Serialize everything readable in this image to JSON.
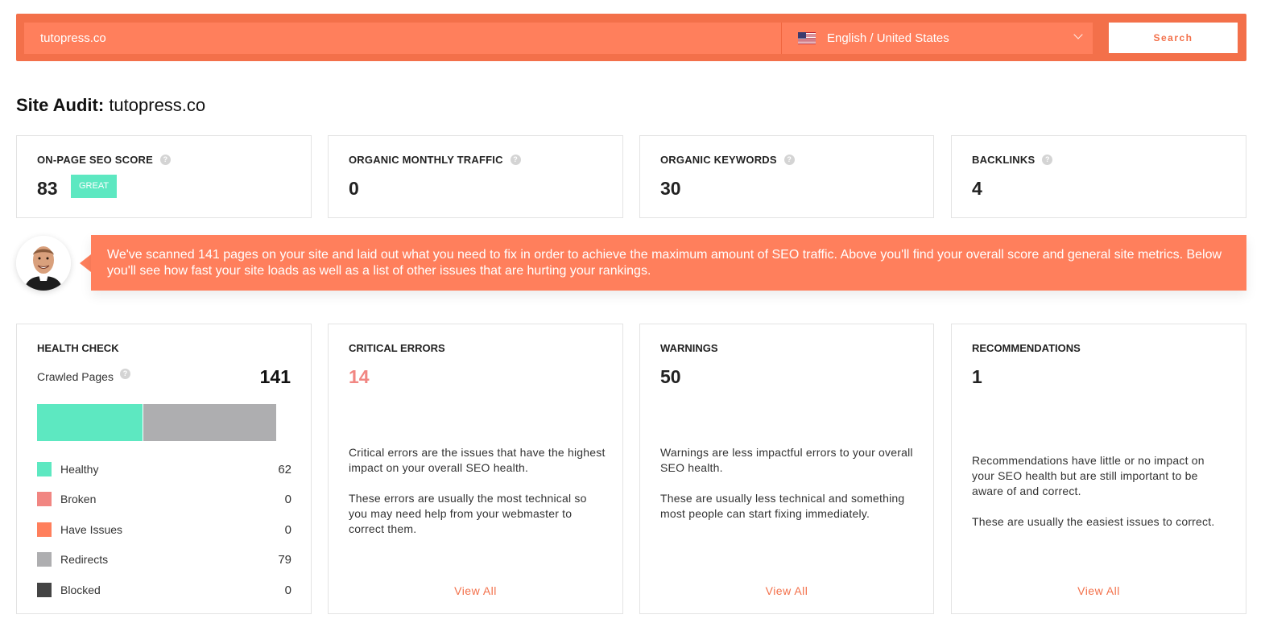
{
  "search": {
    "query": "tutopress.co",
    "language": "English / United States",
    "button_label": "Search"
  },
  "title": {
    "prefix": "Site Audit:",
    "domain": "tutopress.co"
  },
  "metrics": [
    {
      "label": "ON-PAGE SEO SCORE",
      "value": "83",
      "badge": "GREAT"
    },
    {
      "label": "ORGANIC MONTHLY TRAFFIC",
      "value": "0"
    },
    {
      "label": "ORGANIC KEYWORDS",
      "value": "30"
    },
    {
      "label": "BACKLINKS",
      "value": "4"
    }
  ],
  "banner": {
    "text": "We've scanned 141 pages on your site and laid out what you need to fix in order to achieve the maximum amount of SEO traffic. Above you'll find your overall score and general site metrics. Below you'll see how fast your site loads as well as a list of other issues that are hurting your rankings."
  },
  "health_check": {
    "label": "HEALTH CHECK",
    "crawled_label": "Crawled Pages",
    "crawled_value": "141",
    "legend": [
      {
        "label": "Healthy",
        "value": "62",
        "color": "#5de8c1"
      },
      {
        "label": "Broken",
        "value": "0",
        "color": "#f18682"
      },
      {
        "label": "Have Issues",
        "value": "0",
        "color": "#ff7f5c"
      },
      {
        "label": "Redirects",
        "value": "79",
        "color": "#aeaeb0"
      },
      {
        "label": "Blocked",
        "value": "0",
        "color": "#444444"
      }
    ]
  },
  "critical": {
    "label": "CRITICAL ERRORS",
    "value": "14",
    "desc1": "Critical errors are the issues that have the highest impact on your overall SEO health.",
    "desc2": "These errors are usually the most technical so you may need help from your webmaster to correct them.",
    "link": "View All"
  },
  "warnings": {
    "label": "WARNINGS",
    "value": "50",
    "desc1": "Warnings are less impactful errors to your overall SEO health.",
    "desc2": "These are usually less technical and something most people can start fixing immediately.",
    "link": "View All"
  },
  "recommendations": {
    "label": "RECOMMENDATIONS",
    "value": "1",
    "desc1": "Recommendations have little or no impact on your SEO health but are still important to be aware of and correct.",
    "desc2": "These are usually the easiest issues to correct.",
    "link": "View All"
  },
  "colors": {
    "accent": "#f3704a",
    "accent_light": "#ff7f5c",
    "healthy": "#5de8c1"
  }
}
